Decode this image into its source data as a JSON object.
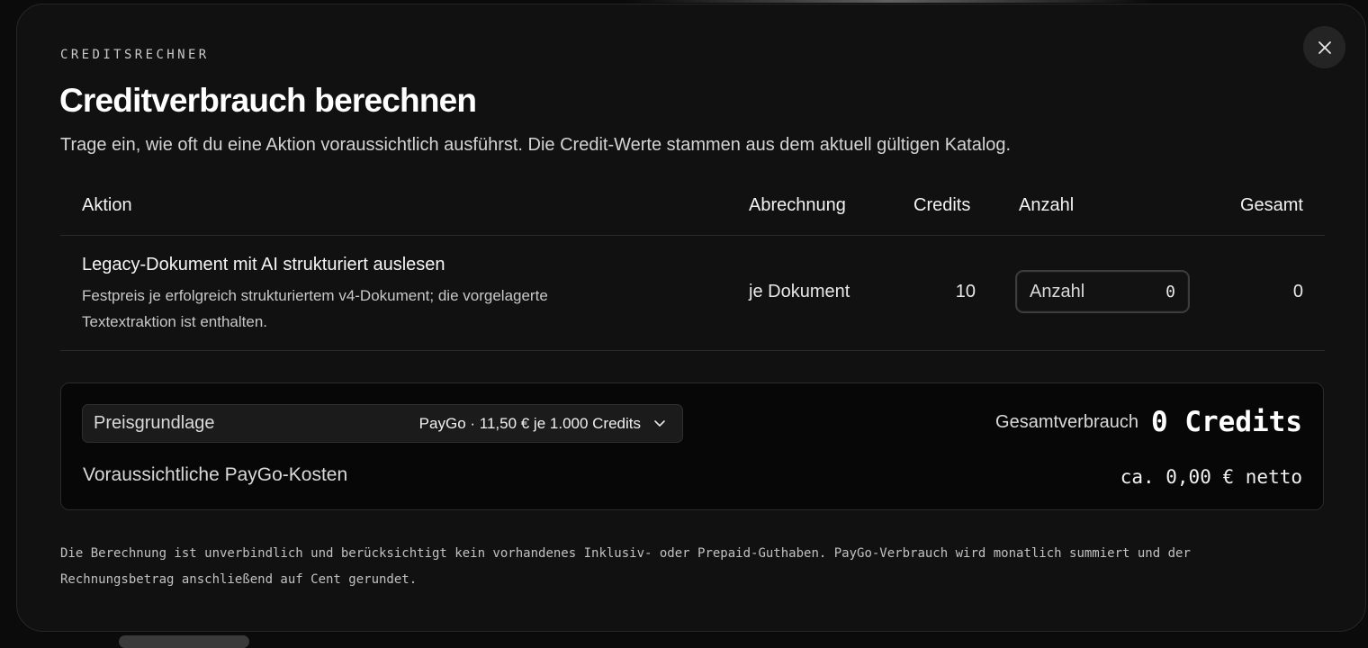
{
  "modal": {
    "eyebrow": "CREDITSRECHNER",
    "title": "Creditverbrauch berechnen",
    "subtitle": "Trage ein, wie oft du eine Aktion voraussichtlich ausführst. Die Credit-Werte stammen aus dem aktuell gültigen Katalog.",
    "close_icon": "close-icon"
  },
  "table": {
    "headers": {
      "action": "Aktion",
      "billing": "Abrechnung",
      "credits": "Credits",
      "quantity": "Anzahl",
      "total": "Gesamt"
    },
    "rows": [
      {
        "name": "Legacy-Dokument mit AI strukturiert auslesen",
        "description": "Festpreis je erfolgreich strukturiertem v4-Dokument; die vorgelagerte Textextraktion ist enthalten.",
        "billing": "je Dokument",
        "credits": "10",
        "quantity_label": "Anzahl",
        "quantity_value": "0",
        "total": "0"
      }
    ]
  },
  "summary": {
    "price_basis_label": "Preisgrundlage",
    "price_basis_value": "PayGo · 11,50 € je 1.000 Credits",
    "total_usage_label": "Gesamtverbrauch",
    "total_usage_value": "0 Credits",
    "cost_label": "Voraussichtliche PayGo-Kosten",
    "cost_value": "ca. 0,00 € netto"
  },
  "disclaimer": "Die Berechnung ist unverbindlich und berücksichtigt kein vorhandenes Inklusiv- oder Prepaid-Guthaben. PayGo-Verbrauch wird monatlich summiert und der Rechnungsbetrag anschließend auf Cent gerundet.",
  "colors": {
    "background": "#0b0b0b",
    "modal": "#111111",
    "summary_panel": "#070707",
    "text": "#f2f2f2"
  }
}
